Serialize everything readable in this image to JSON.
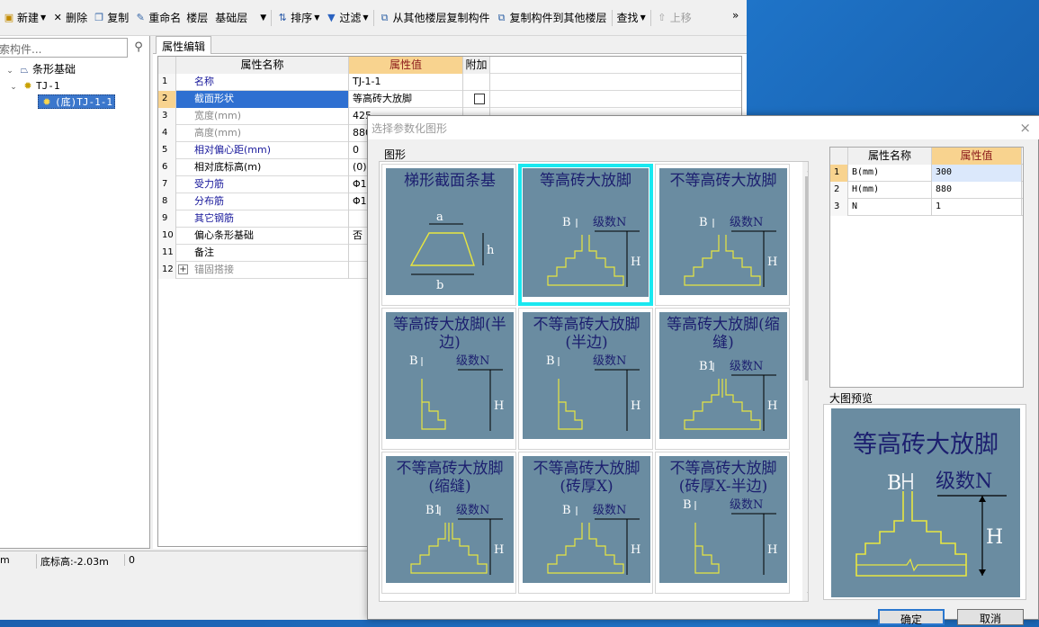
{
  "toolbar": {
    "new": "新建",
    "delete": "删除",
    "copy": "复制",
    "rename": "重命名",
    "floor_label": "楼层",
    "floor_value": "基础层",
    "sort": "排序",
    "filter": "过滤",
    "copy_from_floor": "从其他楼层复制构件",
    "copy_to_floor": "复制构件到其他楼层",
    "find": "查找",
    "move_up": "上移",
    "more": "»"
  },
  "search": {
    "placeholder": "索构件..."
  },
  "tree": {
    "root": "条形基础",
    "child": "TJ-1",
    "leaf": "(底)TJ-1-1"
  },
  "tab": "属性编辑",
  "grid": {
    "headers": [
      "属性名称",
      "属性值",
      "附加"
    ],
    "rows": [
      {
        "n": "1",
        "name": "名称",
        "value": "TJ-1-1",
        "color": "blue"
      },
      {
        "n": "2",
        "name": "截面形状",
        "value": "等高砖大放脚",
        "color": "blue"
      },
      {
        "n": "3",
        "name": "宽度(mm)",
        "value": "425",
        "color": "gray"
      },
      {
        "n": "4",
        "name": "高度(mm)",
        "value": "880",
        "color": "gray"
      },
      {
        "n": "5",
        "name": "相对偏心距(mm)",
        "value": "0",
        "color": "blue"
      },
      {
        "n": "6",
        "name": "相对底标高(m)",
        "value": "(0)",
        "color": "black"
      },
      {
        "n": "7",
        "name": "受力筋",
        "value": "Φ1",
        "color": "blue"
      },
      {
        "n": "8",
        "name": "分布筋",
        "value": "Φ1",
        "color": "blue"
      },
      {
        "n": "9",
        "name": "其它钢筋",
        "value": "",
        "color": "blue"
      },
      {
        "n": "10",
        "name": "偏心条形基础",
        "value": "否",
        "color": "black"
      },
      {
        "n": "11",
        "name": "备注",
        "value": "",
        "color": "black"
      },
      {
        "n": "12",
        "name": "锚固搭接",
        "value": "",
        "color": "gray"
      }
    ]
  },
  "status": {
    "left": "m",
    "base": "底标高:-2.03m",
    "val": "0"
  },
  "dialog": {
    "title": "选择参数化图形",
    "close": "×",
    "gallery_label": "图形",
    "cards": [
      {
        "cap": "梯形截面条基"
      },
      {
        "cap": "等高砖大放脚"
      },
      {
        "cap": "不等高砖大放脚"
      },
      {
        "cap": "等高砖大放脚(半边)"
      },
      {
        "cap": "不等高砖大放脚(半边)"
      },
      {
        "cap": "等高砖大放脚(缩缝)"
      },
      {
        "cap": "不等高砖大放脚(缩缝)"
      },
      {
        "cap": "不等高砖大放脚(砖厚X)"
      },
      {
        "cap": "不等高砖大放脚(砖厚X-半边)"
      }
    ],
    "prop_headers": [
      "属性名称",
      "属性值"
    ],
    "props": [
      {
        "n": "1",
        "name": "B(mm)",
        "value": "300"
      },
      {
        "n": "2",
        "name": "H(mm)",
        "value": "880"
      },
      {
        "n": "3",
        "name": "N",
        "value": "1"
      }
    ],
    "preview_label": "大图预览",
    "preview_caption": "等高砖大放脚",
    "ok": "确定",
    "cancel": "取消"
  }
}
